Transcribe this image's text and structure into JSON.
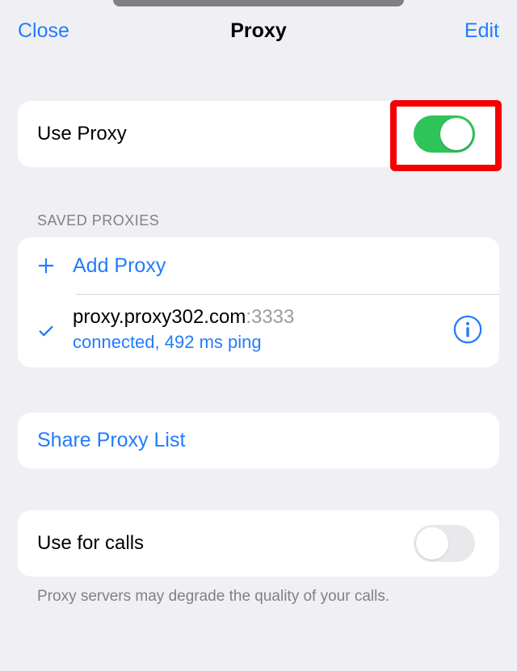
{
  "navbar": {
    "left": "Close",
    "title": "Proxy",
    "right": "Edit"
  },
  "useProxy": {
    "label": "Use Proxy",
    "on": true
  },
  "section": {
    "header": "SAVED PROXIES"
  },
  "addProxy": {
    "label": "Add Proxy"
  },
  "proxyEntry": {
    "host": "proxy.proxy302.com",
    "portDisplay": ":3333",
    "status": "connected, 492 ms ping",
    "selected": true
  },
  "share": {
    "label": "Share Proxy List"
  },
  "useForCalls": {
    "label": "Use for calls",
    "on": false
  },
  "footer": {
    "note": "Proxy servers may degrade the quality of your calls."
  }
}
